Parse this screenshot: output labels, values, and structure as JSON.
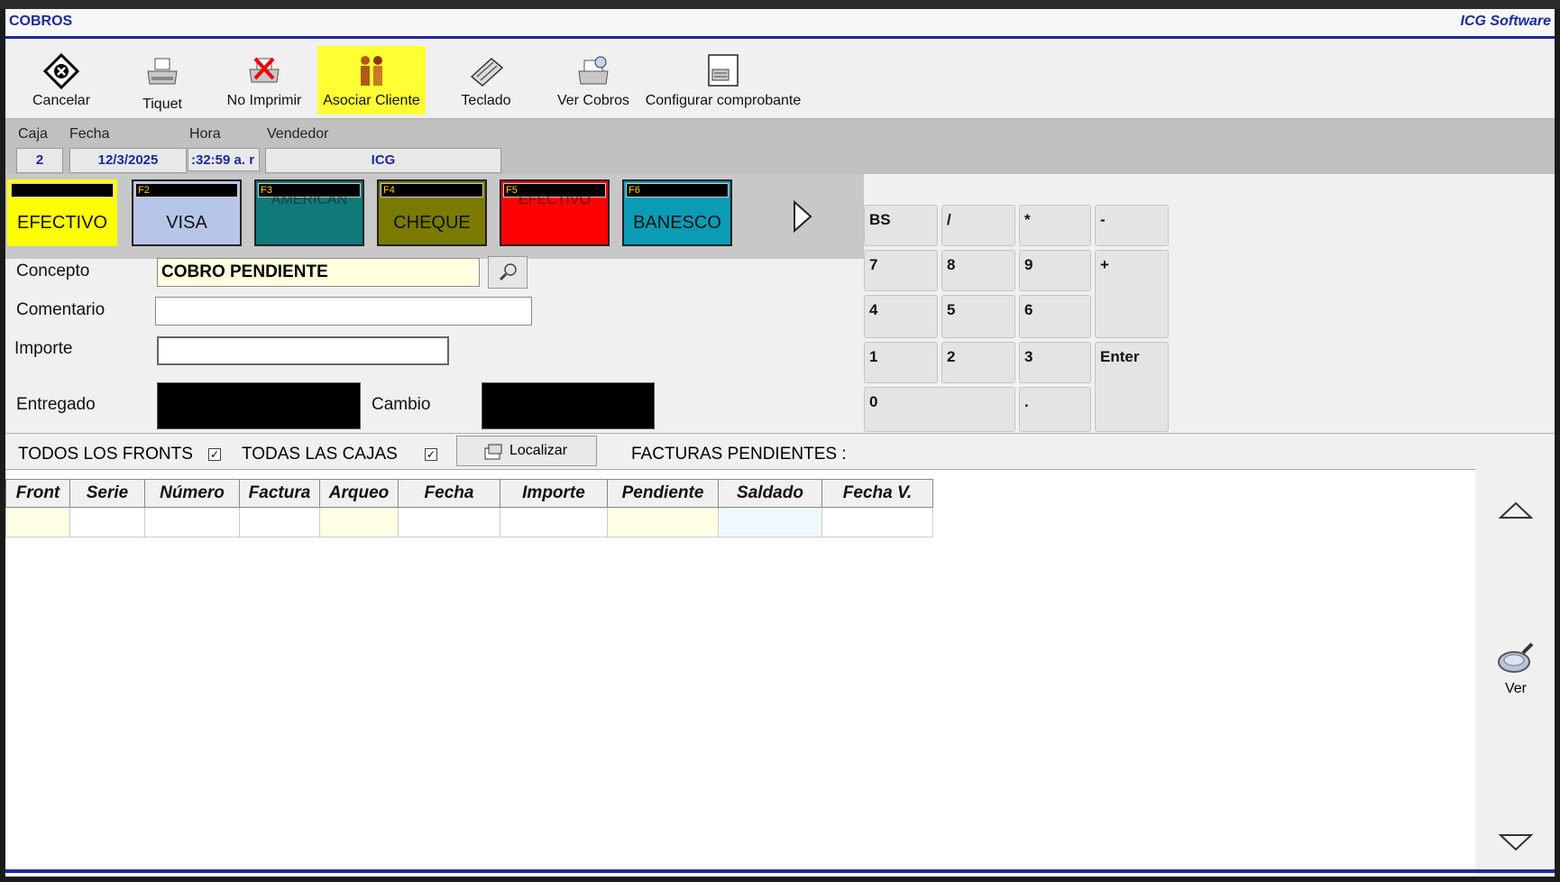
{
  "window": {
    "title": "COBROS",
    "brand": "ICG Software"
  },
  "toolbar": [
    {
      "label": "Cancelar",
      "icon": "cancel-icon"
    },
    {
      "label": "Tiquet",
      "icon": "printer-icon"
    },
    {
      "label": "No Imprimir",
      "icon": "no-print-icon"
    },
    {
      "label": "Asociar Cliente",
      "icon": "people-icon"
    },
    {
      "label": "Teclado",
      "icon": "keyboard-icon"
    },
    {
      "label": "Ver Cobros",
      "icon": "view-payments-icon"
    },
    {
      "label": "Configurar comprobante",
      "icon": "receipt-config-icon"
    }
  ],
  "info": {
    "caja_label": "Caja",
    "caja": "2",
    "fecha_label": "Fecha",
    "fecha": "12/3/2025",
    "hora_label": "Hora",
    "hora": ":32:59 a. r",
    "vendedor_label": "Vendedor",
    "vendedor": "ICG"
  },
  "payment_methods": [
    {
      "key": "",
      "name": "EFECTIVO",
      "color": "#ffff00"
    },
    {
      "key": "F2",
      "name": "VISA",
      "color": "#b7c6e8"
    },
    {
      "key": "F3",
      "name": "AMERICAN",
      "color": "#0f7a78"
    },
    {
      "key": "F4",
      "name": "CHEQUE",
      "color": "#7a7a00"
    },
    {
      "key": "F5",
      "name": "EFECTIVO",
      "color": "#ff0000"
    },
    {
      "key": "F6",
      "name": "BANESCO",
      "color": "#0a9bb5"
    }
  ],
  "form": {
    "concepto_label": "Concepto",
    "concepto_value": "COBRO PENDIENTE",
    "comentario_label": "Comentario",
    "comentario_value": "",
    "importe_label": "Importe",
    "importe_value": "",
    "entregado_label": "Entregado",
    "cambio_label": "Cambio"
  },
  "keypad": {
    "bs": "BS",
    "slash": "/",
    "star": "*",
    "minus": "-",
    "k7": "7",
    "k8": "8",
    "k9": "9",
    "plus": "+",
    "k4": "4",
    "k5": "5",
    "k6": "6",
    "k1": "1",
    "k2": "2",
    "k3": "3",
    "enter": "Enter",
    "k0": "0",
    "dot": "."
  },
  "filters": {
    "todos_fronts": "TODOS LOS FRONTS",
    "todas_cajas": "TODAS LAS CAJAS",
    "localizar": "Localizar",
    "facturas_pendientes": "FACTURAS PENDIENTES :"
  },
  "grid": {
    "columns": [
      "Front",
      "Serie",
      "Número",
      "Factura",
      "Arqueo",
      "Fecha",
      "Importe",
      "Pendiente",
      "Saldado",
      "Fecha V."
    ]
  },
  "side": {
    "ver": "Ver"
  }
}
